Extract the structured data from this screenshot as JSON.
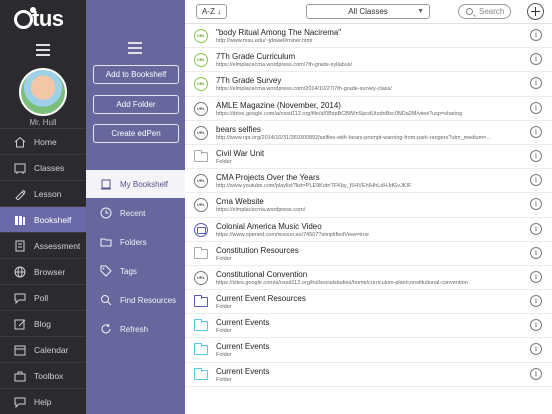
{
  "app": {
    "logo": "tus"
  },
  "nav": {
    "user_name": "Mr. Hull",
    "items": [
      {
        "label": "Home",
        "icon": "home-icon"
      },
      {
        "label": "Classes",
        "icon": "classes-icon"
      },
      {
        "label": "Lesson",
        "icon": "lesson-icon"
      },
      {
        "label": "Bookshelf",
        "icon": "bookshelf-icon"
      },
      {
        "label": "Assessment",
        "icon": "assessment-icon"
      },
      {
        "label": "Browser",
        "icon": "globe-icon"
      },
      {
        "label": "Poll",
        "icon": "poll-icon"
      },
      {
        "label": "Blog",
        "icon": "blog-icon"
      },
      {
        "label": "Calendar",
        "icon": "calendar-icon"
      },
      {
        "label": "Toolbox",
        "icon": "toolbox-icon"
      },
      {
        "label": "Help",
        "icon": "help-icon"
      }
    ],
    "active": "Bookshelf"
  },
  "mid": {
    "add_to_bookshelf": "Add to Bookshelf",
    "add_folder": "Add Folder",
    "create_edpen": "Create edPen",
    "items": [
      {
        "label": "My Bookshelf",
        "icon": "book-icon"
      },
      {
        "label": "Recent",
        "icon": "clock-icon"
      },
      {
        "label": "Folders",
        "icon": "folder-icon"
      },
      {
        "label": "Tags",
        "icon": "tag-icon"
      },
      {
        "label": "Find Resources",
        "icon": "search-icon"
      },
      {
        "label": "Refresh",
        "icon": "refresh-icon"
      }
    ]
  },
  "toolbar": {
    "sort_label": "A-Z ↓",
    "class_filter": "All Classes",
    "search_placeholder": "Search"
  },
  "list": [
    {
      "title": "\"body Ritual Among The Nacirema\"",
      "sub": "http://www.msu.edu/~jdowell/miner.html",
      "icon": "url-green"
    },
    {
      "title": "7Th Grade Curriculum",
      "sub": "https://elmplacecma.wordpress.com/7th-grade-syllabus/",
      "icon": "url-green"
    },
    {
      "title": "7Th Grade Survey",
      "sub": "https://elmplacecma.wordpress.com/2014/10/27/7th-grade-survey-class/",
      "icon": "url-green"
    },
    {
      "title": "AMLE Magazine (November, 2014)",
      "sub": "https://drive.google.com/a/nssd112.org/file/d/0BxpBCBWInSpcdUtzdnBxc0NDa2M/view?usp=sharing",
      "icon": "url-gray"
    },
    {
      "title": "bears selfies",
      "sub": "http://www.npr.org/2014/10/31/360300892/selfies-with-bears-prompt-warning-from-park-rangers?utm_medium=...",
      "icon": "url-gray"
    },
    {
      "title": "Civil War Unit",
      "sub": "Folder",
      "icon": "folder-gray"
    },
    {
      "title": "CMA Projects Over the Years",
      "sub": "http://www.youtube.com/playlist?list=PLE9KotnTFKby_I5HVEhIHhLdHJdGvJKIF",
      "icon": "url-gray"
    },
    {
      "title": "Cma Website",
      "sub": "https://elmplacecma.wordpress.com/",
      "icon": "url-gray"
    },
    {
      "title": "Colonial America Music Video",
      "sub": "https://www.opened.com/resources/74507?simplifiedView=true",
      "icon": "video"
    },
    {
      "title": "Constitution Resources",
      "sub": "Folder",
      "icon": "folder-gray"
    },
    {
      "title": "Constitutional Convention",
      "sub": "https://sites.google.com/a/nssd112.org/hullsocialstudies/home/curriculum-plan/constitutional-convention",
      "icon": "url-gray"
    },
    {
      "title": "Current Event Resources",
      "sub": "Folder",
      "icon": "folder-purple"
    },
    {
      "title": "Current Events",
      "sub": "Folder",
      "icon": "folder-teal"
    },
    {
      "title": "Current Events",
      "sub": "Folder",
      "icon": "folder-teal"
    },
    {
      "title": "Current Events",
      "sub": "Folder",
      "icon": "folder-teal"
    }
  ],
  "url_badge": "URL",
  "info_glyph": "i"
}
